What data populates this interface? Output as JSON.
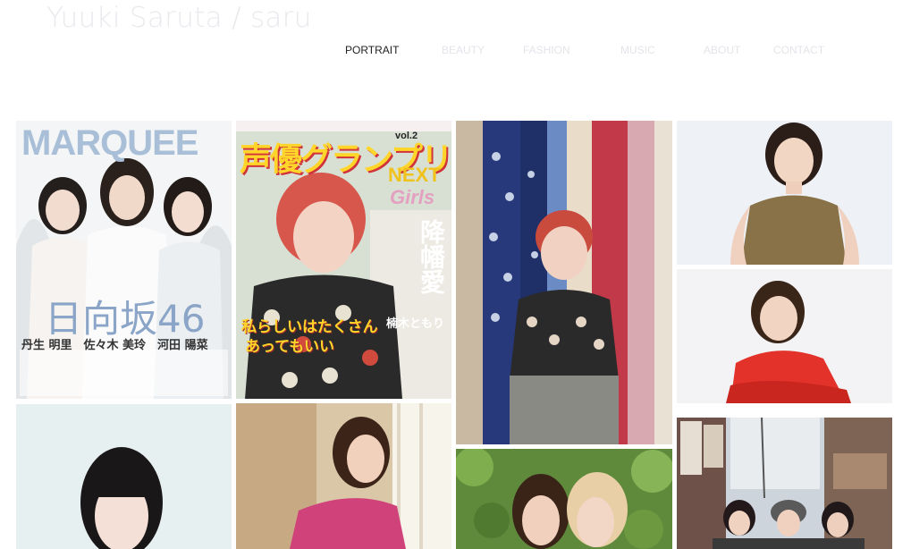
{
  "site": {
    "title": "Yuuki Saruta / saru"
  },
  "nav": {
    "items": [
      {
        "label": "PORTRAIT",
        "active": true
      },
      {
        "label": "BEAUTY",
        "active": false
      },
      {
        "label": "FASHION",
        "active": false
      },
      {
        "label": "MUSIC",
        "active": false
      },
      {
        "label": "ABOUT",
        "active": false
      },
      {
        "label": "CONTACT",
        "active": false
      }
    ]
  },
  "covers": {
    "marquee": {
      "masthead": "MARQUEE",
      "headline": "日向坂46",
      "names": "丹生 明里　佐々木 美玲　河田 陽菜"
    },
    "seiyu": {
      "masthead": "声優グランプリ",
      "subtitle": "NEXT",
      "sub2": "Girls",
      "vol": "vol.2",
      "feature": "降幡愛",
      "tagline": "私らしいはたくさん",
      "tagline2": "あってもいい",
      "cover_name": "楠木ともり"
    }
  },
  "colors": {
    "accent_text": "#222222",
    "faded_text": "#e4e4ea"
  }
}
